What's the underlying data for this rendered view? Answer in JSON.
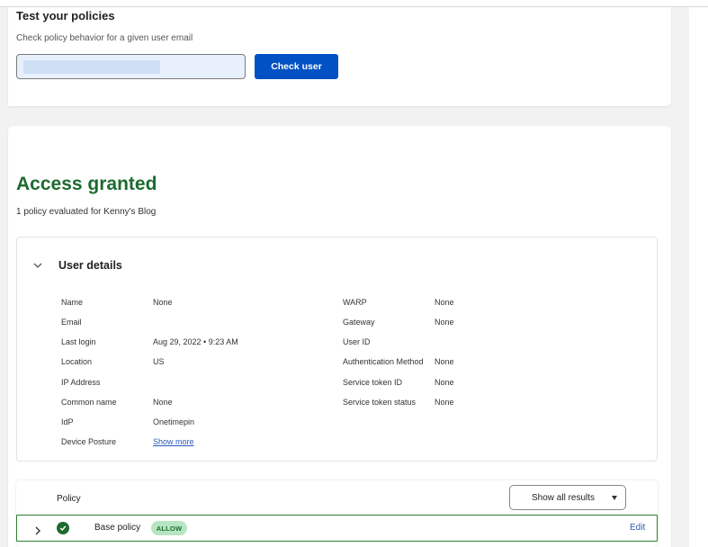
{
  "test": {
    "title": "Test your policies",
    "subtitle": "Check policy behavior for a given user email",
    "email_value": "",
    "check_button": "Check user"
  },
  "result": {
    "title": "Access granted",
    "subtitle": "1 policy evaluated for Kenny's Blog"
  },
  "user_details": {
    "title": "User details",
    "left": [
      {
        "label": "Name",
        "value": "None"
      },
      {
        "label": "Email",
        "value": ""
      },
      {
        "label": "Last login",
        "value": "Aug 29, 2022 • 9:23 AM"
      },
      {
        "label": "Location",
        "value": "US"
      },
      {
        "label": "IP Address",
        "value": ""
      },
      {
        "label": "Common name",
        "value": "None"
      },
      {
        "label": "IdP",
        "value": "Onetimepin"
      },
      {
        "label": "Device Posture",
        "value": "Show more"
      }
    ],
    "right": [
      {
        "label": "WARP",
        "value": "None"
      },
      {
        "label": "Gateway",
        "value": "None"
      },
      {
        "label": "User ID",
        "value": ""
      },
      {
        "label": "Authentication Method",
        "value": "None"
      },
      {
        "label": "Service token ID",
        "value": "None"
      },
      {
        "label": "Service token status",
        "value": "None"
      }
    ]
  },
  "policies": {
    "header": "Policy",
    "filter_selected": "Show all results",
    "rows": [
      {
        "name": "Base policy",
        "decision": "ALLOW",
        "action": "Edit"
      }
    ]
  },
  "colors": {
    "accent_blue": "#0051c3",
    "granted_green": "#1d6b2f",
    "allow_badge_bg": "#b6e6c1"
  }
}
